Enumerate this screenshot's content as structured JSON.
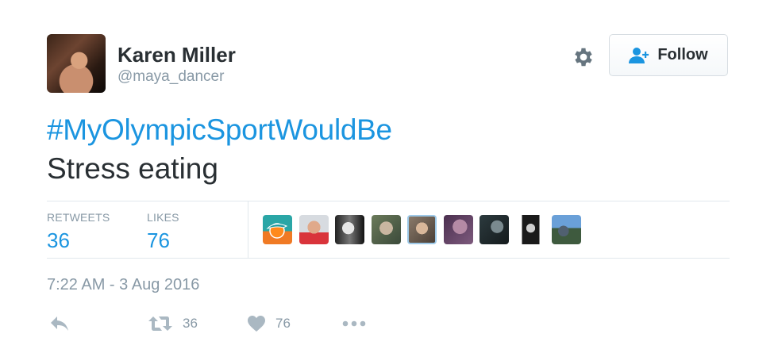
{
  "user": {
    "name": "Karen Miller",
    "handle": "@maya_dancer"
  },
  "follow_button": {
    "label": "Follow"
  },
  "tweet": {
    "hashtag": "#MyOlympicSportWouldBe",
    "text": "Stress eating"
  },
  "stats": {
    "retweets_label": "RETWEETS",
    "retweets_count": "36",
    "likes_label": "LIKES",
    "likes_count": "76"
  },
  "likers": [
    {
      "label": "Miami Dolphins logo avatar",
      "icon": "dolphin-logo-icon"
    },
    {
      "label": "man in red shirt avatar"
    },
    {
      "label": "black and white skull avatar"
    },
    {
      "label": "bearded man avatar"
    },
    {
      "label": "woman portrait avatar"
    },
    {
      "label": "purple profile avatar"
    },
    {
      "label": "dark room avatar"
    },
    {
      "label": "black and white figure avatar"
    },
    {
      "label": "outdoor group avatar"
    }
  ],
  "timestamp": "7:22 AM - 3 Aug 2016",
  "actions": {
    "reply_icon": "reply-icon",
    "retweet_icon": "retweet-icon",
    "retweet_count": "36",
    "like_icon": "heart-icon",
    "like_count": "76",
    "more_icon": "more-icon"
  },
  "colors": {
    "link_blue": "#1b95e0",
    "text_dark": "#292f33",
    "text_muted": "#8899a6",
    "icon_gray": "#aab8c2",
    "divider": "#e1e8ed"
  }
}
